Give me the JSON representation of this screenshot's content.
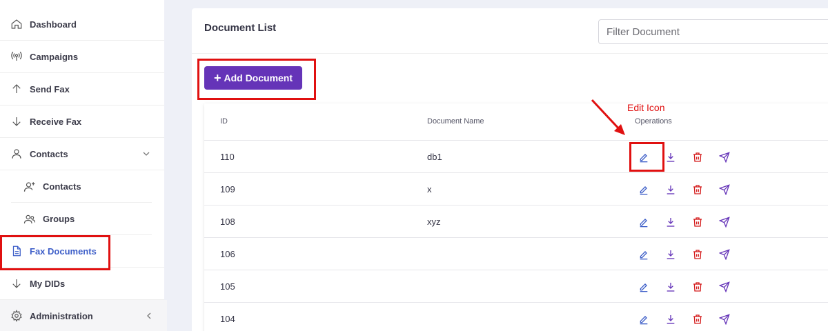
{
  "sidebar": {
    "items": [
      {
        "label": "Dashboard",
        "icon": "home-icon"
      },
      {
        "label": "Campaigns",
        "icon": "broadcast-icon"
      },
      {
        "label": "Send Fax",
        "icon": "arrow-up-icon"
      },
      {
        "label": "Receive Fax",
        "icon": "arrow-down-icon"
      },
      {
        "label": "Contacts",
        "icon": "user-icon"
      },
      {
        "label": "Contacts",
        "icon": "user-plus-icon"
      },
      {
        "label": "Groups",
        "icon": "users-icon"
      },
      {
        "label": "Fax Documents",
        "icon": "document-icon"
      },
      {
        "label": "My DIDs",
        "icon": "arrow-down-icon"
      },
      {
        "label": "Administration",
        "icon": "gear-icon"
      }
    ]
  },
  "main": {
    "title": "Document List",
    "filter_placeholder": "Filter Document",
    "add_button_label": "Add Document",
    "table": {
      "columns": [
        "ID",
        "Document Name",
        "Operations"
      ],
      "rows": [
        {
          "id": "110",
          "name": "db1"
        },
        {
          "id": "109",
          "name": "x"
        },
        {
          "id": "108",
          "name": "xyz"
        },
        {
          "id": "106",
          "name": ""
        },
        {
          "id": "105",
          "name": ""
        },
        {
          "id": "104",
          "name": ""
        }
      ],
      "operations": [
        "edit-icon",
        "download-icon",
        "delete-icon",
        "send-icon"
      ]
    }
  },
  "annotation": {
    "text": "Edit Icon",
    "color": "#e01010"
  },
  "colors": {
    "accent": "#6534b8",
    "active_nav": "#3d5ec8",
    "edit": "#3d5ec8",
    "download": "#6534b8",
    "delete": "#d41a1a",
    "send": "#6534b8"
  }
}
